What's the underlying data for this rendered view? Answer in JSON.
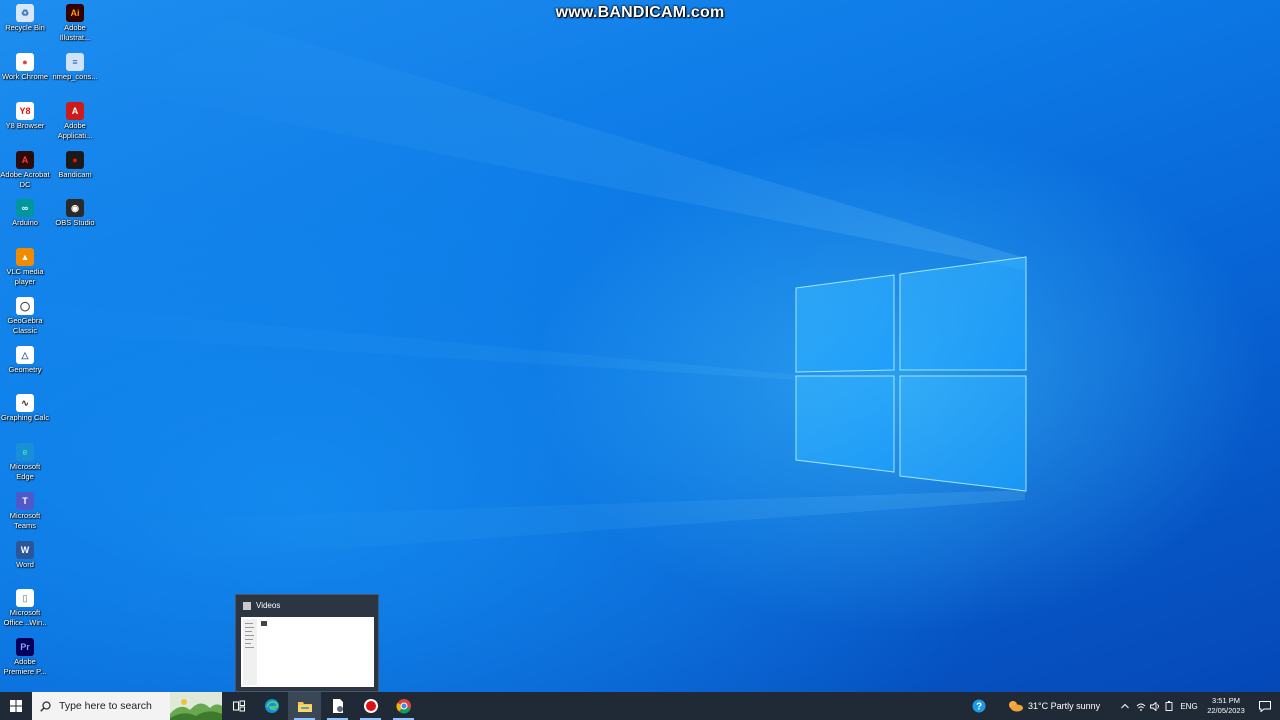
{
  "watermark": "www.BANDICAM.com",
  "desktop_icons": [
    {
      "label": "Recycle Bin",
      "icon": "recycle-bin-icon",
      "color": "#d8e6f5"
    },
    {
      "label": "Adobe Illustrat...",
      "icon": "adobe-illustrator-icon",
      "color": "#330000"
    },
    {
      "label": "Work Chrome",
      "icon": "chrome-icon",
      "color": "#ffffff"
    },
    {
      "label": "nmep_cons...",
      "icon": "file-icon",
      "color": "#cfe3ff"
    },
    {
      "label": "Y8 Browser",
      "icon": "y8-browser-icon",
      "color": "#ffffff"
    },
    {
      "label": "Adobe Applicati...",
      "icon": "adobe-icon",
      "color": "#cc1b1b"
    },
    {
      "label": "Adobe Acrobat DC",
      "icon": "acrobat-icon",
      "color": "#2b0b0b"
    },
    {
      "label": "Bandicam",
      "icon": "bandicam-icon",
      "color": "#1a1a1a"
    },
    {
      "label": "Arduino",
      "icon": "arduino-icon",
      "color": "#00979c"
    },
    {
      "label": "OBS Studio",
      "icon": "obs-icon",
      "color": "#2a2a2a"
    },
    {
      "label": "VLC media player",
      "icon": "vlc-icon",
      "color": "#f08a00"
    },
    {
      "label": "GeoGebra Classic",
      "icon": "geogebra-icon",
      "color": "#ffffff"
    },
    {
      "label": "Geometry",
      "icon": "geometry-icon",
      "color": "#ffffff"
    },
    {
      "label": "Graphing Calc",
      "icon": "graphing-calc-icon",
      "color": "#ffffff"
    },
    {
      "label": "Microsoft Edge",
      "icon": "edge-icon",
      "color": "#1a8fd8"
    },
    {
      "label": "Microsoft Teams",
      "icon": "teams-icon",
      "color": "#5059c9"
    },
    {
      "label": "Word",
      "icon": "word-icon",
      "color": "#2b579a"
    },
    {
      "label": "Microsoft Office ..Win..",
      "icon": "document-icon",
      "color": "#ffffff"
    },
    {
      "label": "Adobe Premiere P...",
      "icon": "premiere-icon",
      "color": "#00005b"
    }
  ],
  "preview": {
    "title": "Videos"
  },
  "taskbar": {
    "search_placeholder": "Type here to search",
    "apps": [
      "task-view-icon",
      "edge-icon",
      "file-explorer-icon",
      "document-icon",
      "bandicam-icon",
      "chrome-icon"
    ],
    "weather": "31°C  Partly sunny",
    "language": "ENG",
    "time": "3:51 PM",
    "date": "22/05/2023"
  }
}
